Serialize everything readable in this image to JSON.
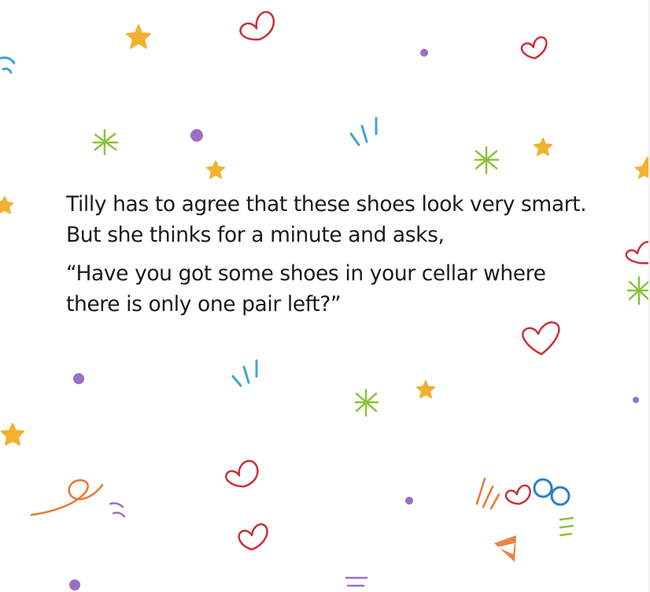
{
  "page": {
    "paragraphs": [
      "Tilly has to agree that these shoes look very smart. But she thinks for a minute and asks,",
      "“Have you got some shoes in your cellar where there is only one pair left?”"
    ]
  },
  "colors": {
    "text": "#1a1a1a",
    "star": "#f2b12e",
    "heart": "#c8313a",
    "asterisk": "#8cc23d",
    "dot": "#9b6fc4",
    "dash": "#3ca6cf",
    "orange": "#e8792e"
  },
  "decorations": [
    "star-icon",
    "heart-icon",
    "asterisk-icon",
    "dot-icon",
    "dash-icon",
    "swirl-icon",
    "rings-icon"
  ]
}
